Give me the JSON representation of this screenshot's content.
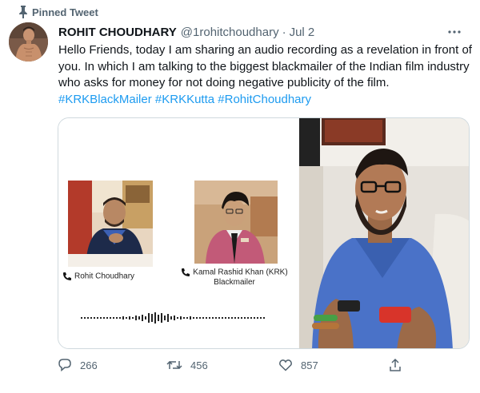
{
  "pinned": {
    "label": "Pinned Tweet",
    "icon": "pin-icon"
  },
  "author": {
    "name": "ROHIT CHOUDHARY",
    "handle": "@1rohitchoudhary",
    "separator": "·",
    "date": "Jul 2"
  },
  "tweet": {
    "text": "Hello Friends, today I am sharing an audio recording as a revelation in front of you. In which I am talking to the biggest blackmailer of the Indian film industry who asks for money for not doing negative publicity of the film.",
    "hashtags": [
      "#KRKBlackMailer",
      "#KRKKutta",
      "#RohitChoudhary"
    ]
  },
  "media": {
    "caller1": {
      "label": "Rohit Choudhary",
      "icon": "phone-icon"
    },
    "caller2": {
      "line1": "Kamal Rashid Khan (KRK)",
      "line2": "Blackmailer",
      "icon": "phone-icon"
    }
  },
  "actions": {
    "reply": {
      "count": "266",
      "icon": "reply-icon"
    },
    "retweet": {
      "count": "456",
      "icon": "retweet-icon"
    },
    "like": {
      "count": "857",
      "icon": "heart-icon"
    },
    "share": {
      "icon": "share-icon"
    }
  },
  "colors": {
    "link": "#1d9bf0",
    "secondary_text": "#536471",
    "primary_text": "#0f1419",
    "border": "#cfd9de"
  }
}
